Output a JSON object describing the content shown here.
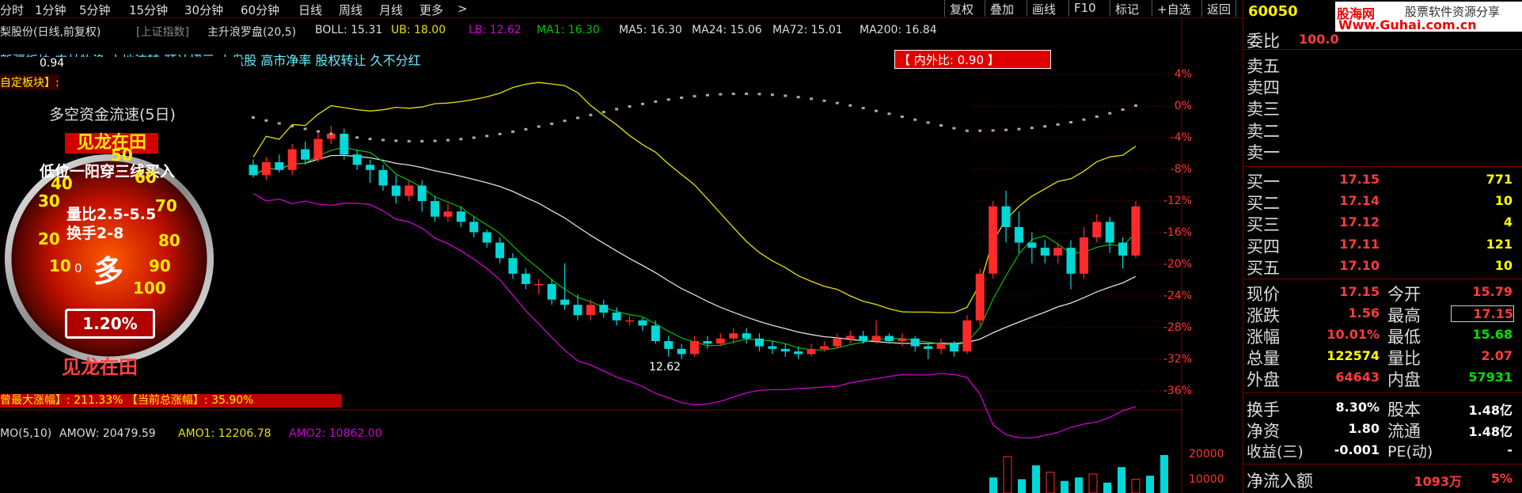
{
  "toolbar": {
    "periods": [
      "分时",
      "1分钟",
      "5分钟",
      "15分钟",
      "30分钟",
      "60分钟",
      "日线",
      "周线",
      "月线",
      "更多"
    ],
    "more_chevron": ">",
    "right_buttons": [
      "复权",
      "叠加",
      "画线",
      "F10",
      "标记",
      "+自选",
      "返回"
    ]
  },
  "chart_header": {
    "stock": "梨股份(日线,前复权)",
    "index": "[上证指数]",
    "indicator": "主升浪罗盘(20,5)",
    "boll": "BOLL: 15.31",
    "ub": "UB: 18.00",
    "lb": "LB: 12.62",
    "ma1": "MA1: 16.30",
    "ma5": "MA5: 16.30",
    "ma24": "MA24: 15.06",
    "ma72": "MA72: 15.01",
    "ma200": "MA200: 16.84"
  },
  "concepts": "新疆板块 农林牧渔 土地流转 预计扭亏 小盘股 高市净率 股权转让 久不分红",
  "custom_block": "自定板块】:",
  "gauge": {
    "title": "多空资金流速(5日)",
    "brand": "见龙在田",
    "line1": "低位一阳穿三线买入",
    "line2": "量比2.5-5.5",
    "line3": "换手2-8",
    "ticks": [
      "0",
      "10",
      "20",
      "30",
      "40",
      "50",
      "60",
      "70",
      "80",
      "90",
      "100"
    ],
    "center": "多",
    "percent": "1.20%",
    "footer": "见龙在田",
    "small_val": "0.94"
  },
  "ratio_box": "【 内外比: 0.90 】",
  "low_label": "12.62",
  "max_gain": "曾最大涨幅】: 211.33% 【当前总涨幅】: 35.90%",
  "price_axis": [
    "4%",
    "0%",
    "-4%",
    "-8%",
    "-12%",
    "-16%",
    "-20%",
    "-24%",
    "-28%",
    "-32%",
    "-36%"
  ],
  "amo": {
    "label": "MO(5,10)",
    "amow": "AMOW: 20479.59",
    "amo1": "AMO1: 12206.78",
    "amo2": "AMO2: 10862.00",
    "axis": [
      "20000",
      "10000"
    ]
  },
  "quote": {
    "code": "60050",
    "logo": "股海网",
    "logo_sub": "股票软件资源分享",
    "url": "Www.Guhai.com.cn",
    "weibi_label": "委比",
    "weibi_value": "100.0",
    "sell_labels": [
      "卖五",
      "卖四",
      "卖三",
      "卖二",
      "卖一"
    ],
    "buy": [
      {
        "label": "买一",
        "price": "17.15",
        "vol": "771"
      },
      {
        "label": "买二",
        "price": "17.14",
        "vol": "10"
      },
      {
        "label": "买三",
        "price": "17.12",
        "vol": "4"
      },
      {
        "label": "买四",
        "price": "17.11",
        "vol": "121"
      },
      {
        "label": "买五",
        "price": "17.10",
        "vol": "10"
      }
    ],
    "stats": [
      {
        "l1": "现价",
        "v1": "17.15",
        "l2": "今开",
        "v2": "15.79"
      },
      {
        "l1": "涨跌",
        "v1": "1.56",
        "l2": "最高",
        "v2": "17.15"
      },
      {
        "l1": "涨幅",
        "v1": "10.01%",
        "l2": "最低",
        "v2": "15.68"
      },
      {
        "l1": "总量",
        "v1": "122574",
        "l2": "量比",
        "v2": "2.07"
      },
      {
        "l1": "外盘",
        "v1": "64643",
        "l2": "内盘",
        "v2": "57931"
      }
    ],
    "stats2": [
      {
        "l1": "换手",
        "v1": "8.30%",
        "l2": "股本",
        "v2": "1.48亿"
      },
      {
        "l1": "净资",
        "v1": "1.80",
        "l2": "流通",
        "v2": "1.48亿"
      },
      {
        "l1": "收益(三)",
        "v1": "-0.001",
        "l2": "PE(动)",
        "v2": "-"
      }
    ],
    "netflow_label": "净流入额",
    "netflow_value": "1093万",
    "netflow_pct": "5%"
  },
  "colors": {
    "up": "#ff2a2a",
    "down": "#00d8d8",
    "bg": "#000000",
    "ub": "#e8e000",
    "lb": "#d000d0",
    "mid": "#e0e0e0",
    "ma": "#00c000"
  },
  "candles": [
    [
      15.3,
      15.1,
      15.4,
      15.05
    ],
    [
      15.1,
      15.35,
      15.45,
      15.0
    ],
    [
      15.35,
      15.2,
      15.5,
      15.15
    ],
    [
      15.2,
      15.6,
      15.7,
      15.1
    ],
    [
      15.6,
      15.4,
      15.75,
      15.3
    ],
    [
      15.4,
      15.8,
      15.95,
      15.35
    ],
    [
      15.8,
      15.9,
      16.05,
      15.7
    ],
    [
      15.9,
      15.5,
      16.0,
      15.4
    ],
    [
      15.5,
      15.3,
      15.6,
      15.2
    ],
    [
      15.3,
      15.2,
      15.4,
      14.95
    ],
    [
      15.2,
      14.9,
      15.3,
      14.8
    ],
    [
      14.9,
      14.7,
      15.1,
      14.55
    ],
    [
      14.7,
      14.9,
      15.0,
      14.6
    ],
    [
      14.9,
      14.6,
      15.0,
      14.4
    ],
    [
      14.6,
      14.3,
      14.7,
      14.2
    ],
    [
      14.3,
      14.4,
      14.55,
      14.2
    ],
    [
      14.4,
      14.2,
      14.5,
      14.1
    ],
    [
      14.2,
      14.0,
      14.3,
      13.9
    ],
    [
      14.0,
      13.8,
      14.05,
      13.7
    ],
    [
      13.8,
      13.5,
      13.9,
      13.4
    ],
    [
      13.5,
      13.2,
      13.6,
      13.1
    ],
    [
      13.2,
      13.0,
      13.3,
      12.9
    ],
    [
      13.0,
      13.0,
      13.1,
      12.8
    ],
    [
      13.0,
      12.7,
      13.1,
      12.6
    ],
    [
      12.7,
      12.6,
      13.4,
      12.5
    ],
    [
      12.6,
      12.4,
      12.8,
      12.3
    ],
    [
      12.4,
      12.6,
      12.7,
      12.3
    ],
    [
      12.6,
      12.45,
      12.7,
      12.35
    ],
    [
      12.45,
      12.3,
      12.55,
      12.2
    ],
    [
      12.3,
      12.3,
      12.4,
      12.2
    ],
    [
      12.3,
      12.2,
      12.35,
      12.1
    ],
    [
      12.2,
      11.9,
      12.3,
      11.85
    ],
    [
      11.9,
      11.75,
      12.0,
      11.6
    ],
    [
      11.75,
      11.65,
      11.85,
      11.55
    ],
    [
      11.65,
      11.9,
      12.0,
      11.6
    ],
    [
      11.9,
      11.85,
      12.0,
      11.75
    ],
    [
      11.85,
      11.95,
      12.05,
      11.8
    ],
    [
      11.95,
      12.05,
      12.15,
      11.85
    ],
    [
      12.05,
      11.95,
      12.15,
      11.85
    ],
    [
      11.95,
      11.8,
      12.05,
      11.7
    ],
    [
      11.8,
      11.75,
      11.9,
      11.65
    ],
    [
      11.75,
      11.7,
      11.85,
      11.6
    ],
    [
      11.7,
      11.65,
      11.8,
      11.55
    ],
    [
      11.65,
      11.75,
      11.85,
      11.6
    ],
    [
      11.75,
      11.8,
      11.9,
      11.7
    ],
    [
      11.8,
      11.95,
      12.05,
      11.75
    ],
    [
      11.95,
      12.0,
      12.1,
      11.85
    ],
    [
      12.0,
      11.9,
      12.1,
      11.85
    ],
    [
      11.9,
      12.0,
      12.3,
      11.85
    ],
    [
      12.0,
      11.9,
      12.05,
      11.85
    ],
    [
      11.9,
      11.95,
      12.05,
      11.8
    ],
    [
      11.95,
      11.8,
      12.0,
      11.7
    ],
    [
      11.8,
      11.75,
      11.85,
      11.55
    ],
    [
      11.75,
      11.85,
      11.95,
      11.65
    ],
    [
      11.85,
      11.7,
      11.9,
      11.6
    ],
    [
      11.7,
      12.3,
      12.4,
      11.65
    ],
    [
      12.3,
      13.2,
      13.3,
      12.2
    ],
    [
      13.2,
      14.5,
      14.6,
      13.1
    ],
    [
      14.5,
      14.1,
      14.8,
      13.8
    ],
    [
      14.1,
      13.8,
      14.4,
      13.6
    ],
    [
      13.8,
      13.7,
      14.0,
      13.4
    ],
    [
      13.7,
      13.55,
      13.85,
      13.4
    ],
    [
      13.55,
      13.7,
      13.8,
      13.4
    ],
    [
      13.7,
      13.2,
      13.85,
      12.9
    ],
    [
      13.2,
      13.9,
      14.1,
      13.1
    ],
    [
      13.9,
      14.2,
      14.35,
      13.8
    ],
    [
      14.2,
      13.8,
      14.3,
      13.6
    ],
    [
      13.8,
      13.55,
      13.9,
      13.3
    ],
    [
      13.55,
      14.5,
      14.6,
      13.5
    ]
  ],
  "amo_bars": [
    9000,
    21000,
    8000,
    16000,
    12000,
    7000,
    9000,
    11000,
    6000,
    15000,
    8000,
    10000,
    22000
  ]
}
